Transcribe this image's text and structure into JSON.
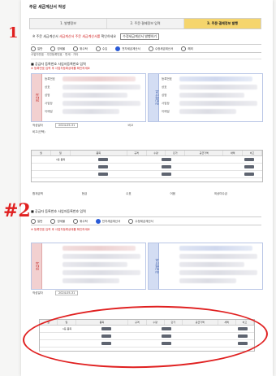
{
  "screen": {
    "title": "주문 세금계산서 작성",
    "steps": [
      "1. 발행정보",
      "2. 주문·결제정보 입력",
      "3. 주문·결제정보 발행"
    ]
  },
  "notice": {
    "prefix": "※ 주문 세금계산서",
    "red_text": "세금계산서 주문 세금계산서를",
    "suffix": "확인하세요",
    "button_label": "수정세금계산서 발행하기"
  },
  "section1": {
    "radio_options": [
      "일반",
      "영세율",
      "위수탁",
      "수입",
      "위수탁영세율",
      "전자세금계산서",
      "수정세금계산서",
      "주민번호",
      "해외"
    ],
    "selected_index": 5,
    "sub_options": [
      "사업자번호",
      "주민등록번호",
      "외국인",
      "면세",
      "기타",
      "공급",
      "정정",
      "가공"
    ],
    "heading": "■ 공급자 등록번호 사업자등록번호 입력",
    "red_note": "※ 등록번호 입력 후 사업자등록상태를 확인하세요",
    "left_label": "공급자",
    "right_label": "공급받는자",
    "left_fields": [
      "등록번호",
      "상호",
      "성명",
      "사업장",
      "업태",
      "이메일"
    ],
    "right_fields": [
      "등록번호",
      "상호",
      "성명",
      "사업장",
      "업태",
      "이메일"
    ],
    "date_label": "작성일자",
    "date_value": "2024-05-31",
    "note_label": "비고",
    "remark_label": "비고(선택)"
  },
  "table1": {
    "headers": [
      "월",
      "일",
      "품목",
      "규격",
      "수량",
      "단가",
      "공급가액",
      "세액",
      "비고",
      ""
    ],
    "rows": [
      [
        "05",
        "31",
        "1등 품목"
      ],
      [
        "",
        "",
        ""
      ],
      [
        "",
        "",
        ""
      ]
    ],
    "add_button": "추가"
  },
  "summary_row": [
    "합계금액",
    "현금",
    "수표",
    "어음",
    "외상미수금"
  ],
  "annotations": {
    "mark_one": "1",
    "mark_two": "#2"
  },
  "section2": {
    "radio_options": [
      "일반",
      "영세율",
      "위수탁",
      "전자세금계산서",
      "수정세금계산서",
      "해외"
    ],
    "heading": "■ 공급자 등록번호 사업자등록번호 입력",
    "red_note": "※ 등록번호 입력 후 사업자등록상태를 확인하세요",
    "left_label": "공급자",
    "right_label": "공급받는자",
    "date_value": "2024-05-31"
  },
  "table2": {
    "headers": [
      "월",
      "일",
      "품목",
      "규격",
      "수량",
      "단가",
      "공급가액",
      "세액",
      "비고",
      ""
    ],
    "rows": [
      [
        "05",
        "31",
        "1등 품목"
      ],
      [
        "",
        "",
        ""
      ],
      [
        "",
        "",
        ""
      ]
    ]
  },
  "colors": {
    "accent": "#f5d56d",
    "marker": "#e02020",
    "link": "#2a5bd7"
  }
}
